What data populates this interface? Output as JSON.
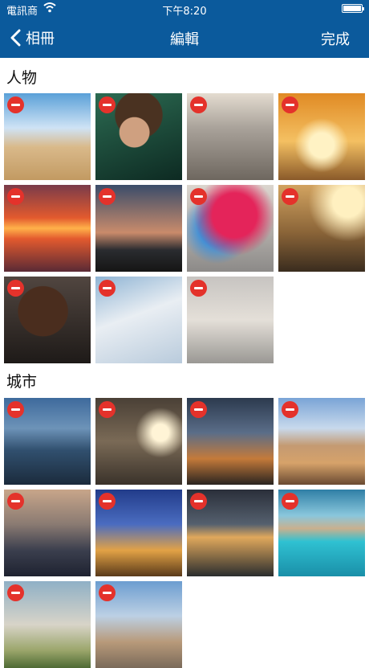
{
  "status_bar": {
    "carrier": "電訊商",
    "time": "下午8:20",
    "battery_level": 1.0
  },
  "nav": {
    "back_label": "相冊",
    "title": "編輯",
    "done_label": "完成"
  },
  "sections": [
    {
      "title": "人物",
      "photo_count": 11
    },
    {
      "title": "城市",
      "photo_count": 10
    }
  ],
  "icons": {
    "back": "chevron-left-icon",
    "wifi": "wifi-icon",
    "battery": "battery-icon",
    "remove": "remove-circle-icon"
  },
  "colors": {
    "nav_background": "#0b5a9c",
    "remove_badge": "#e4322b"
  }
}
